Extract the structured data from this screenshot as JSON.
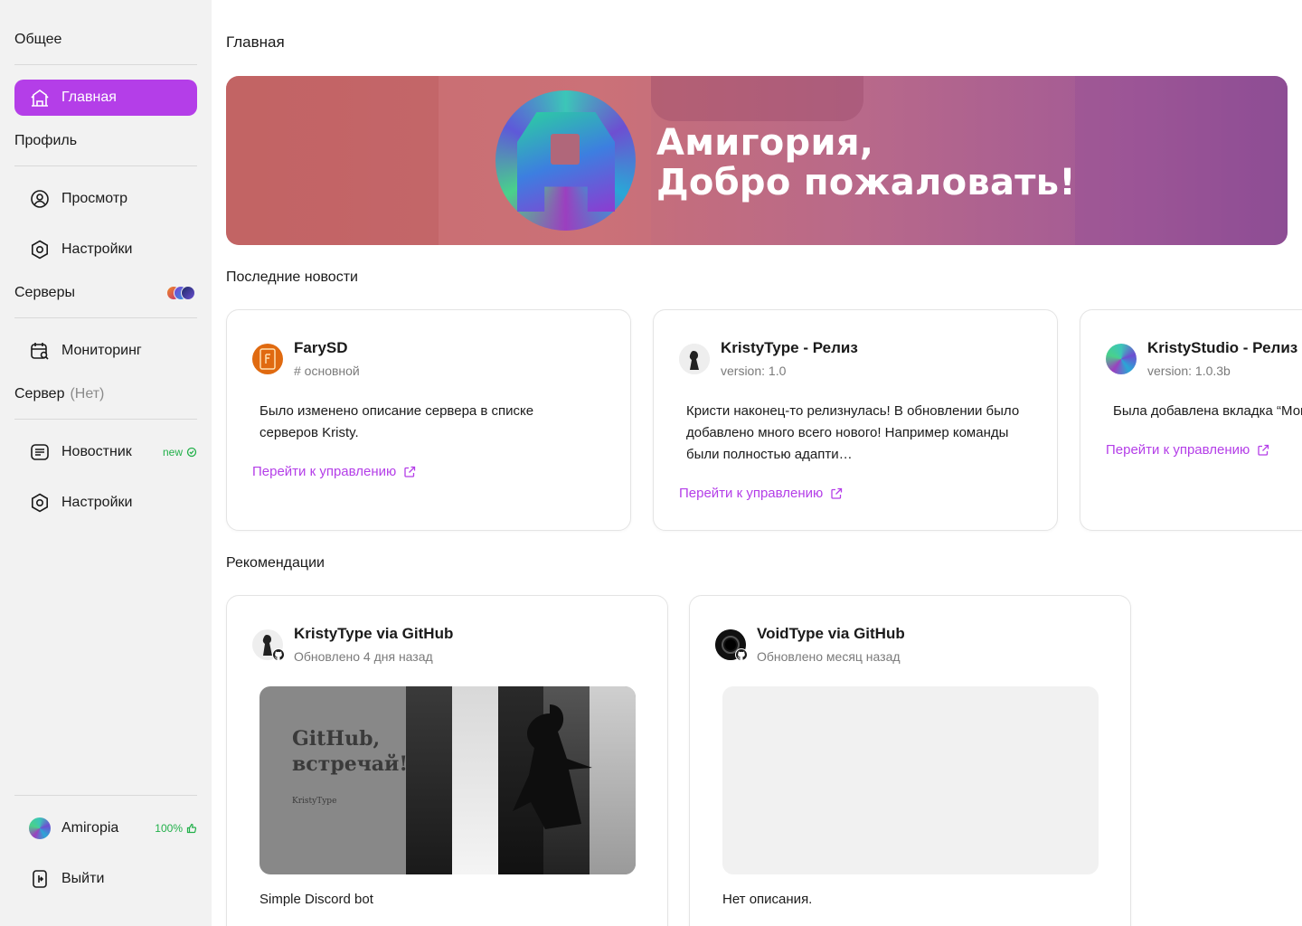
{
  "sidebar": {
    "general_title": "Общее",
    "home_label": "Главная",
    "profile_title": "Профиль",
    "view_label": "Просмотр",
    "profile_settings_label": "Настройки",
    "servers_title": "Серверы",
    "monitoring_label": "Мониторинг",
    "server_title": "Сервер",
    "server_sub": "(Нет)",
    "news_label": "Новостник",
    "news_badge": "new",
    "server_settings_label": "Настройки",
    "user_name": "Amігоріа",
    "user_percent": "100%",
    "logout_label": "Выйти",
    "accent_color": "#b43ee8"
  },
  "main": {
    "page_title": "Главная",
    "banner_line1": "Амигория,",
    "banner_line2": "Добро пожаловать!",
    "news_title": "Последние новости",
    "recommendations_title": "Рекомендации"
  },
  "news": [
    {
      "title": "FarySD",
      "subtitle": "# основной",
      "text": "Было изменено описание  сервера в списке серверов Kristy.",
      "link": "Перейти к управлению"
    },
    {
      "title": "KristyType - Релиз",
      "subtitle": "version: 1.0",
      "text": "Кристи наконец-то релизнулась! В обновлении было добавлено много всего нового! Например команды были полностью адапти…",
      "link": "Перейти к управлению"
    },
    {
      "title": "KristyStudio - Релиз",
      "subtitle": "version: 1.0.3b",
      "text": "Была добавлена вкладка “Мониторинг”",
      "link": "Перейти к управлению"
    }
  ],
  "repos": [
    {
      "title": "KristyType via GitHub",
      "subtitle": "Обновлено 4 дня назад",
      "image_title": "GitHub, встречай!",
      "image_caption": "KristyType",
      "description": "Simple Discord bot"
    },
    {
      "title": "VoidType via GitHub",
      "subtitle": "Обновлено месяц назад",
      "description": "Нет описания."
    }
  ]
}
